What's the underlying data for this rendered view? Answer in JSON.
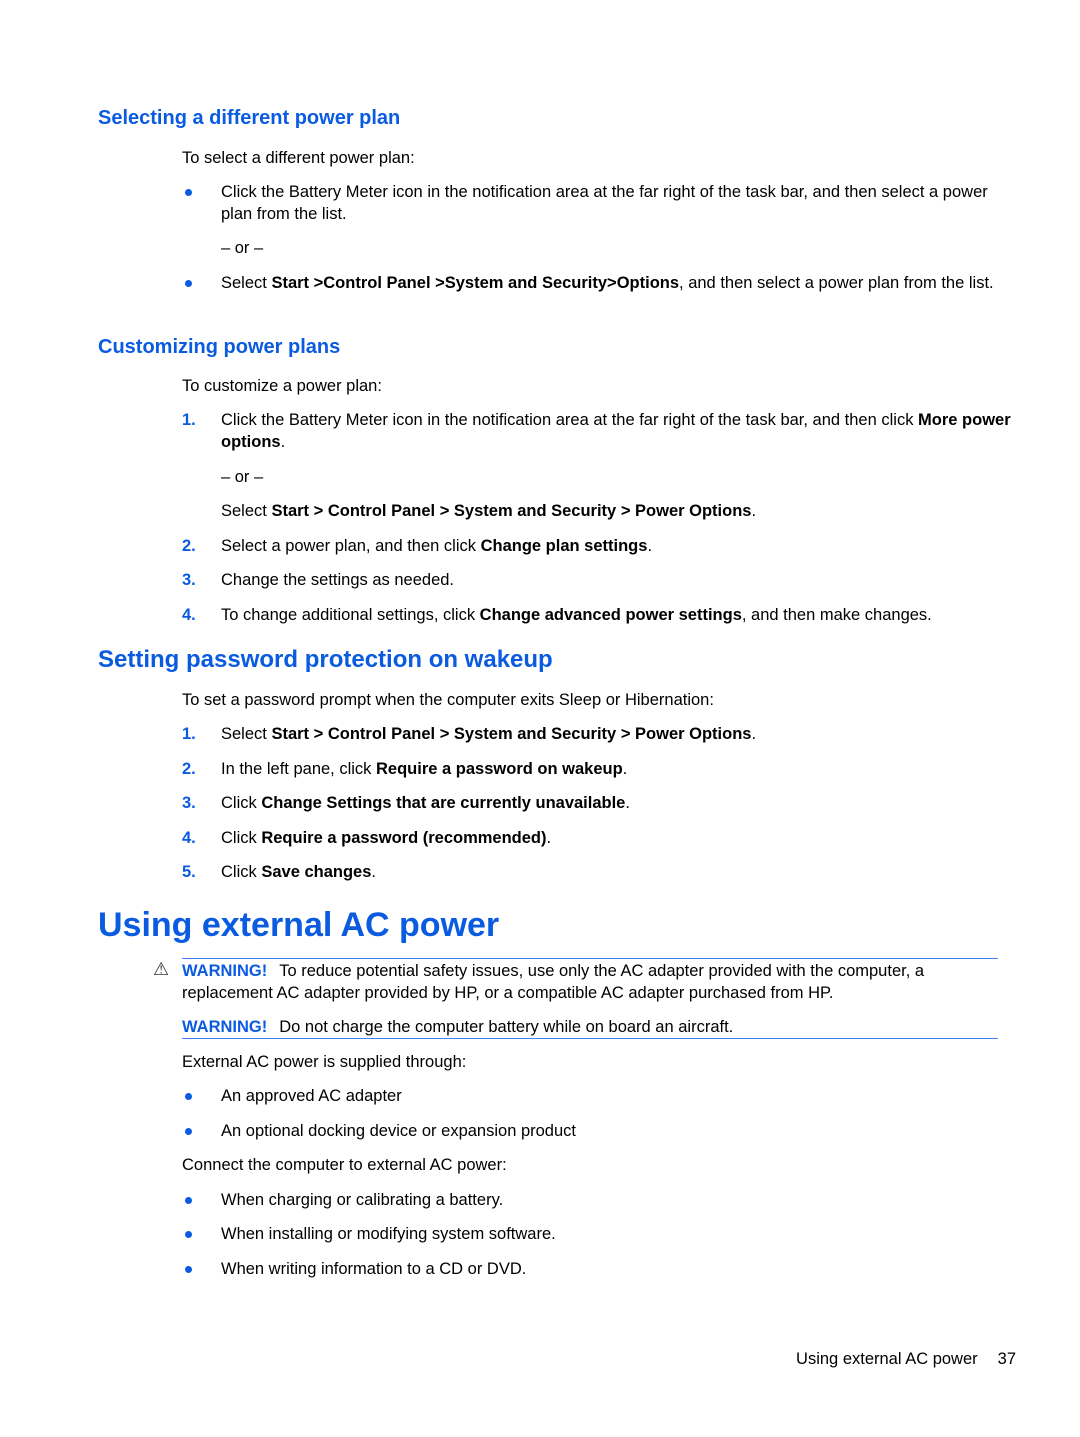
{
  "sections": {
    "select_plan": {
      "heading": "Selecting a different power plan",
      "intro": "To select a different power plan:",
      "item1": "Click the Battery Meter icon in the notification area at the far right of the task bar, and then select a power plan from the list.",
      "or": "– or –",
      "item2_pre": "Select ",
      "item2_bold": "Start >Control Panel >System and Security>Options",
      "item2_post": ", and then select a power plan from the list."
    },
    "customize": {
      "heading": "Customizing power plans",
      "intro": "To customize a power plan:",
      "steps": [
        {
          "num": "1.",
          "pre": "Click the Battery Meter icon in the notification area at the far right of the task bar, and then click ",
          "bold": "More power options",
          "post": "."
        },
        {
          "num": "2.",
          "pre": "Select a power plan, and then click ",
          "bold": "Change plan settings",
          "post": "."
        },
        {
          "num": "3.",
          "pre": "Change the settings as needed.",
          "bold": "",
          "post": ""
        },
        {
          "num": "4.",
          "pre": "To change additional settings, click ",
          "bold": "Change advanced power settings",
          "post": ", and then make changes."
        }
      ],
      "or": "– or –",
      "alt_pre": "Select ",
      "alt_bold": "Start > Control Panel > System and Security > Power Options",
      "alt_post": "."
    },
    "password": {
      "heading": "Setting password protection on wakeup",
      "intro": "To set a password prompt when the computer exits Sleep or Hibernation:",
      "steps": [
        {
          "num": "1.",
          "pre": "Select ",
          "bold": "Start > Control Panel > System and Security > Power Options",
          "post": "."
        },
        {
          "num": "2.",
          "pre": "In the left pane, click ",
          "bold": "Require a password on wakeup",
          "post": "."
        },
        {
          "num": "3.",
          "pre": "Click ",
          "bold": "Change Settings that are currently unavailable",
          "post": "."
        },
        {
          "num": "4.",
          "pre": "Click ",
          "bold": "Require a password (recommended)",
          "post": "."
        },
        {
          "num": "5.",
          "pre": "Click ",
          "bold": "Save changes",
          "post": "."
        }
      ]
    },
    "external_ac": {
      "heading": "Using external AC power",
      "warning1_label": "WARNING!",
      "warning1_text": "To reduce potential safety issues, use only the AC adapter provided with the computer, a replacement AC adapter provided by HP, or a compatible AC adapter purchased from HP.",
      "warning2_label": "WARNING!",
      "warning2_text": "Do not charge the computer battery while on board an aircraft.",
      "supplied_intro": "External AC power is supplied through:",
      "supplied_items": [
        "An approved AC adapter",
        "An optional docking device or expansion product"
      ],
      "connect_intro": "Connect the computer to external AC power:",
      "connect_items": [
        "When charging or calibrating a battery.",
        "When installing or modifying system software.",
        "When writing information to a CD or DVD."
      ]
    }
  },
  "footer": {
    "section": "Using external AC power",
    "page": "37"
  },
  "colors": {
    "accent": "#0a5be0"
  }
}
